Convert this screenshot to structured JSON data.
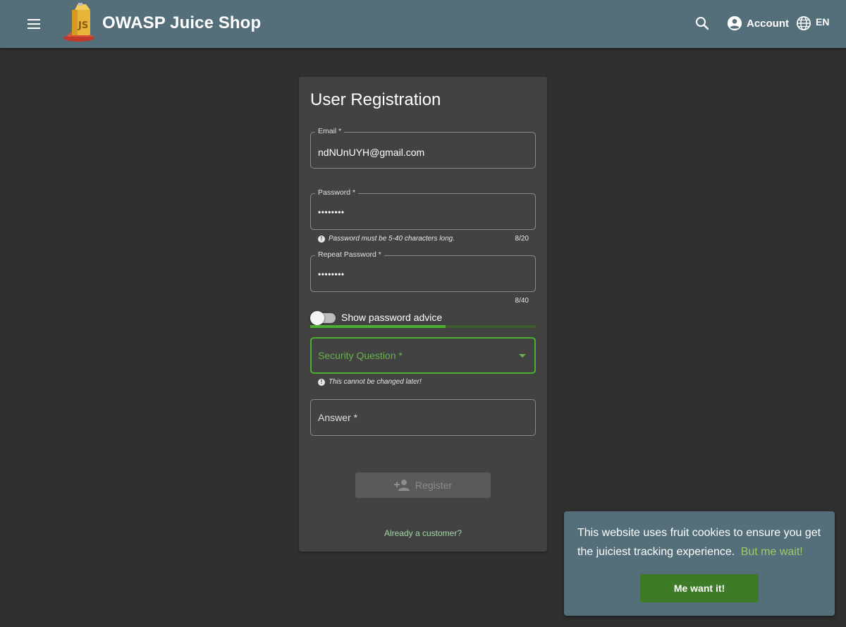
{
  "colors": {
    "toolbar": "#546e7a",
    "background": "#303030",
    "card": "#424242",
    "accent_green": "#4caf30",
    "link_green": "#9ccc65",
    "cookie_button": "#3e7b27"
  },
  "toolbar": {
    "menu_icon": "menu-icon",
    "title": "OWASP Juice Shop",
    "search_icon": "search-icon",
    "account_label": "Account",
    "account_icon": "account-circle-icon",
    "language_label": "EN",
    "language_icon": "globe-icon"
  },
  "registration": {
    "title": "User Registration",
    "email": {
      "label": "Email *",
      "value": "ndNUnUYH@gmail.com"
    },
    "password": {
      "label": "Password *",
      "value": "••••••••",
      "hint": "Password must be 5-40 characters long.",
      "counter": "8/20"
    },
    "repeat_password": {
      "label": "Repeat Password *",
      "value": "••••••••",
      "counter": "8/40"
    },
    "password_advice": {
      "label": "Show password advice",
      "enabled": false,
      "strength": 0.6
    },
    "security_question": {
      "placeholder": "Security Question *",
      "hint": "This cannot be changed later!"
    },
    "answer": {
      "placeholder": "Answer *"
    },
    "register_button": "Register",
    "already_customer": "Already a customer?"
  },
  "cookie_banner": {
    "message": "This website uses fruit cookies to ensure you get the juiciest tracking experience.",
    "more_link": "But me wait!",
    "accept_button": "Me want it!"
  }
}
